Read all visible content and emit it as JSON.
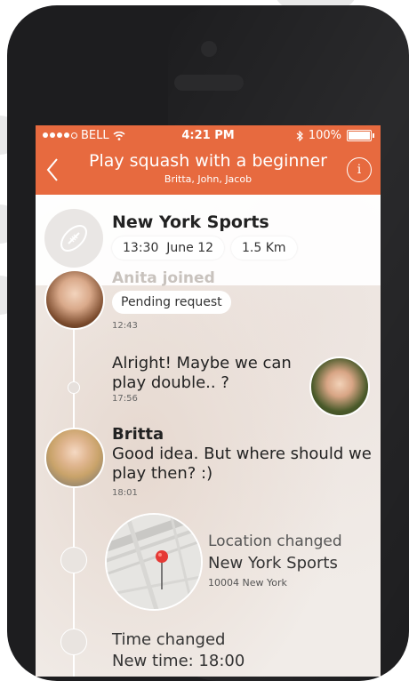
{
  "status_bar": {
    "carrier": "BELL",
    "time": "4:21 PM",
    "battery": "100%"
  },
  "header": {
    "title": "Play squash with a beginner",
    "participants": "Britta, John, Jacob",
    "info_label": "i"
  },
  "event": {
    "venue": "New York Sports",
    "time": "13:30",
    "date": "June 12",
    "distance": "1.5 Km"
  },
  "feed": {
    "join_text": "Anita joined",
    "pending_label": "Pending request",
    "pending_time": "12:43",
    "msg1_line1": "Alright! Maybe we can",
    "msg1_line2": "play double.. ?",
    "msg1_time": "17:56",
    "msg2_author": "Britta",
    "msg2_line1": "Good idea. But where should we",
    "msg2_line2": "play then? :)",
    "msg2_time": "18:01",
    "location_title": "Location changed",
    "location_name": "New York Sports",
    "location_zip": "10004 New York",
    "time_changed_title": "Time changed",
    "new_time_partial": "New time: 18:00"
  },
  "colors": {
    "accent": "#e76a3f",
    "pin": "#e53935"
  },
  "icons": [
    "back-chevron-icon",
    "info-icon",
    "football-icon",
    "wifi-icon",
    "bluetooth-icon",
    "battery-icon",
    "map-pin-icon"
  ]
}
